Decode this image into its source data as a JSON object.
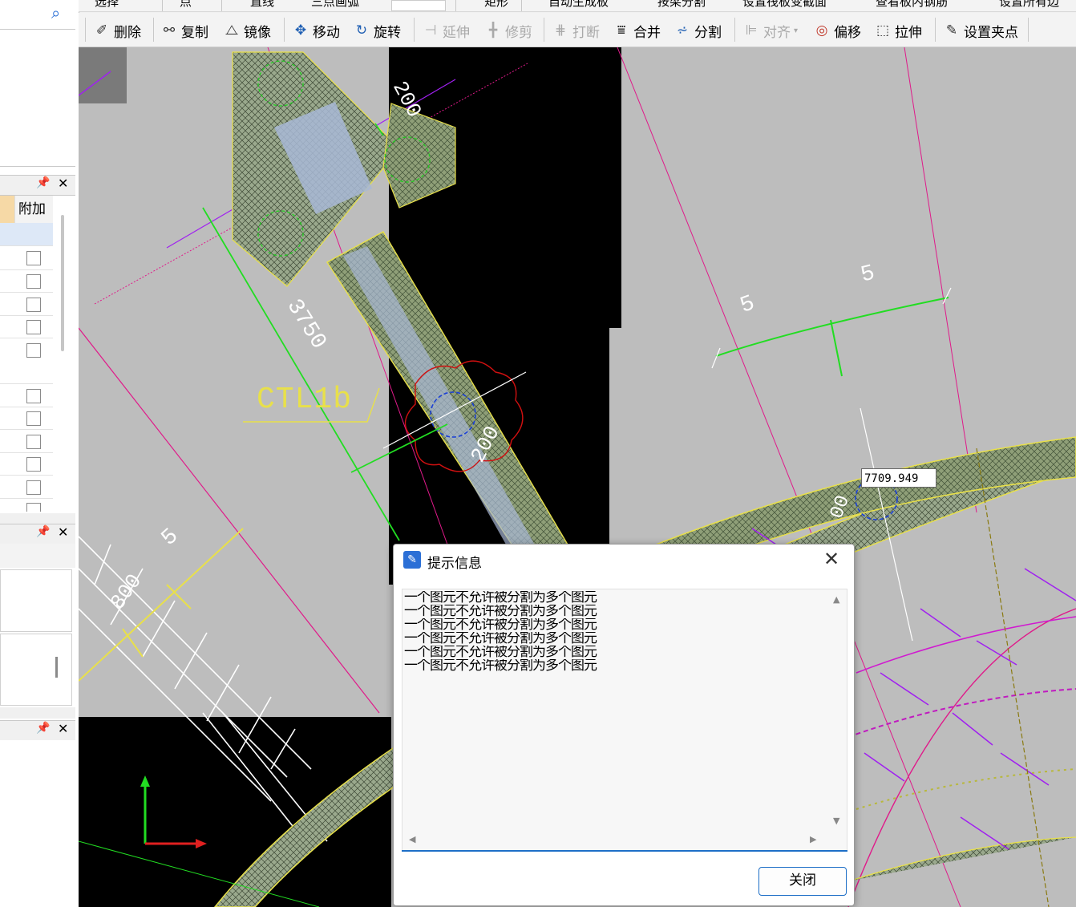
{
  "top_toolbar": {
    "items": [
      "选择",
      "点",
      "直线",
      "三点画弧",
      "矩形",
      "自动生成板",
      "按梁分割",
      "设置筏板变截面",
      "查看板内钢筋",
      "设置所有边"
    ]
  },
  "toolbar": {
    "delete": "删除",
    "copy": "复制",
    "mirror": "镜像",
    "move": "移动",
    "rotate": "旋转",
    "extend": "延伸",
    "trim": "修剪",
    "break": "打断",
    "merge": "合并",
    "split": "分割",
    "align": "对齐",
    "offset": "偏移",
    "stretch": "拉伸",
    "set_grip": "设置夹点"
  },
  "left_panel": {
    "column_header": "附加"
  },
  "canvas": {
    "labels": {
      "dim_200_top": "200",
      "dim_3750": "3750",
      "beam_label": "CTL1b",
      "dim_200_mid": "200",
      "dim_5_left": "5",
      "dim_5_right": "5",
      "dim_5_bottom": "5",
      "dim_800": "800",
      "dim_00_right": "00"
    },
    "coord_readout": "7709.949",
    "colors": {
      "background": "#bdbdbd",
      "hatch_yellow": "#e8e04a",
      "dim_green": "#22dd22",
      "magenta": "#e01a8a"
    }
  },
  "dialog": {
    "title": "提示信息",
    "messages": [
      "一个图元不允许被分割为多个图元",
      "一个图元不允许被分割为多个图元",
      "一个图元不允许被分割为多个图元",
      "一个图元不允许被分割为多个图元",
      "一个图元不允许被分割为多个图元",
      "一个图元不允许被分割为多个图元"
    ],
    "close_button": "关闭"
  }
}
